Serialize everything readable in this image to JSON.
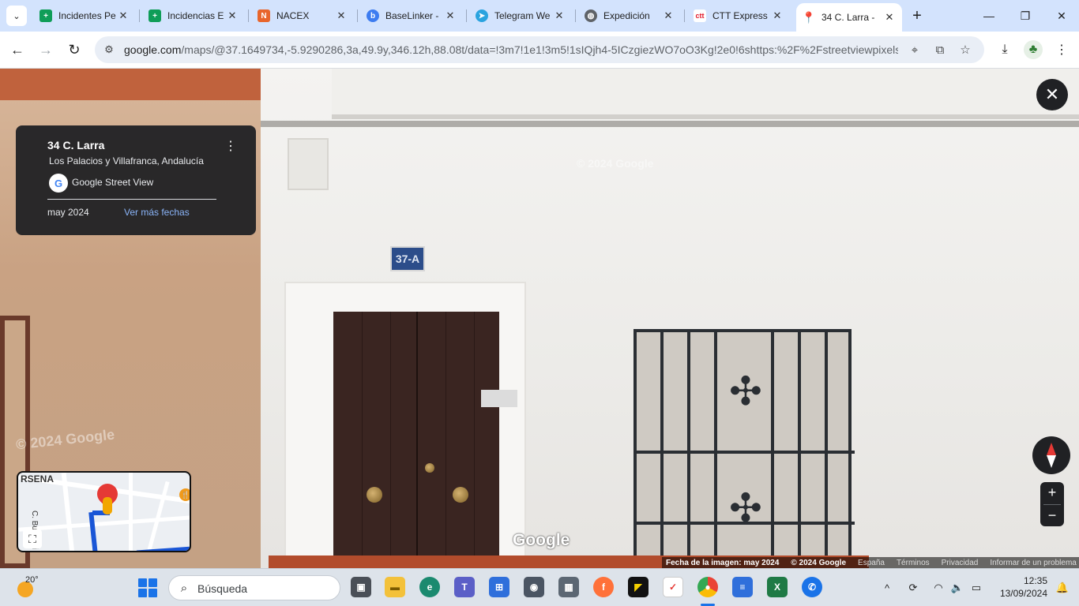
{
  "browser": {
    "tabs": [
      {
        "title": "Incidentes Pe",
        "icon": "sheets-icon",
        "color": "#0f9d58"
      },
      {
        "title": "Incidencias E",
        "icon": "sheets-icon",
        "color": "#0f9d58"
      },
      {
        "title": "NACEX",
        "icon": "nacex-icon",
        "color": "#e8652b"
      },
      {
        "title": "BaseLinker -",
        "icon": "baselinker-icon",
        "color": "#3d7cf0"
      },
      {
        "title": "Telegram We",
        "icon": "telegram-icon",
        "color": "#2aa3df"
      },
      {
        "title": "Expedición",
        "icon": "globe-icon",
        "color": "#5f6368"
      },
      {
        "title": "CTT Express",
        "icon": "ctt-icon",
        "color": "#e21a2c"
      },
      {
        "title": "34 C. Larra -",
        "icon": "google-maps-icon",
        "color": "#34a853",
        "active": true
      }
    ],
    "address_host": "google.com",
    "address_rest": "/maps/@37.1649734,-5.9290286,3a,49.9y,346.12h,88.08t/data=!3m7!1e1!3m5!1sIQjh4-5ICzgiezWO7oO3Kg!2e0!6shttps:%2F%2Fstreetviewpixels-..."
  },
  "streetview": {
    "place_title": "34 C. Larra",
    "place_subtitle": "Los Palacios y Villafranca, Andalucía",
    "source": "Google Street View",
    "capture_date": "may 2024",
    "more_dates_link": "Ver más fechas",
    "house_plate": "37-A",
    "watermark": "© 2024 Google",
    "google_logo": "Google",
    "minimap_label": "RSENA",
    "minimap_street": "C. Buenavi",
    "attribution": {
      "image_date": "Fecha de la imagen: may 2024",
      "copyright": "© 2024 Google",
      "country": "España",
      "terms": "Términos",
      "privacy": "Privacidad",
      "report": "Informar de un problema"
    }
  },
  "taskbar": {
    "weather_temp": "20°",
    "search_placeholder": "Búsqueda",
    "time": "12:35",
    "date": "13/09/2024"
  }
}
